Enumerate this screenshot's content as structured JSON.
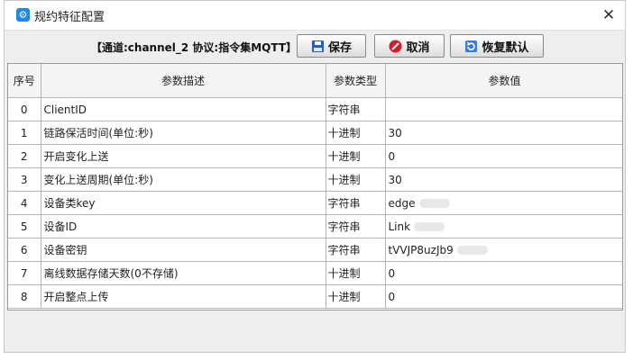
{
  "window": {
    "title": "规约特征配置",
    "icon": "gear-icon",
    "close_glyph": "✕"
  },
  "toolbar": {
    "channel_info": "【通道:channel_2  协议:指令集MQTT】",
    "save_label": "保存",
    "cancel_label": "取消",
    "reset_label": "恢复默认"
  },
  "table": {
    "columns": [
      "序号",
      "参数描述",
      "参数类型",
      "参数值"
    ],
    "rows": [
      {
        "no": "0",
        "desc": "ClientID",
        "type": "字符串",
        "value": ""
      },
      {
        "no": "1",
        "desc": "链路保活时间(单位:秒)",
        "type": "十进制",
        "value": "30"
      },
      {
        "no": "2",
        "desc": "开启变化上送",
        "type": "十进制",
        "value": "0"
      },
      {
        "no": "3",
        "desc": "变化上送周期(单位:秒)",
        "type": "十进制",
        "value": "30"
      },
      {
        "no": "4",
        "desc": "设备类key",
        "type": "字符串",
        "value": "edge"
      },
      {
        "no": "5",
        "desc": "设备ID",
        "type": "字符串",
        "value": "Link"
      },
      {
        "no": "6",
        "desc": "设备密钥",
        "type": "字符串",
        "value": "tVVJP8uzJb9"
      },
      {
        "no": "7",
        "desc": "离线数据存储天数(0不存储)",
        "type": "十进制",
        "value": "0"
      },
      {
        "no": "8",
        "desc": "开启整点上传",
        "type": "十进制",
        "value": "0"
      }
    ]
  }
}
